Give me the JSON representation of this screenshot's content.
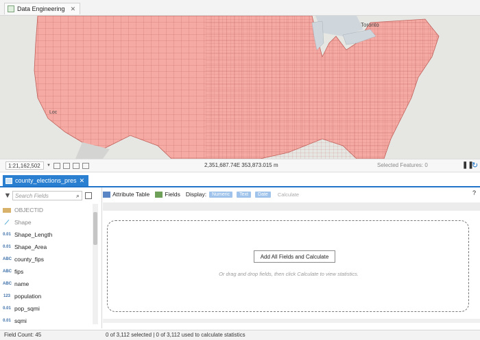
{
  "window": {
    "tab_title": "Data Engineering",
    "tab_icon": "map-view-icon"
  },
  "map": {
    "labels": [
      "Toronto",
      "Loc"
    ],
    "fill_color": "#f5aaa4",
    "border_color": "#c0605a",
    "background_color": "#e6e7e3"
  },
  "map_status": {
    "scale": "1:21,162,502",
    "coordinates": "2,351,687.74E 353,873.015 m",
    "selected_features": "Selected Features: 0"
  },
  "panel": {
    "tab_title": "county_elections_pres"
  },
  "field_search": {
    "placeholder": "Search Fields"
  },
  "fields": [
    {
      "label": "OBJECTID",
      "icon": "objectid-icon",
      "dim": true
    },
    {
      "label": "Shape",
      "icon": "shape-icon",
      "dim": true
    },
    {
      "label": "Shape_Length",
      "icon": "numeric-field-icon",
      "dim": false
    },
    {
      "label": "Shape_Area",
      "icon": "numeric-field-icon",
      "dim": false
    },
    {
      "label": "county_fips",
      "icon": "text-field-icon",
      "dim": false
    },
    {
      "label": "fips",
      "icon": "text-field-icon",
      "dim": false
    },
    {
      "label": "name",
      "icon": "text-field-icon",
      "dim": false
    },
    {
      "label": "population",
      "icon": "integer-field-icon",
      "dim": false
    },
    {
      "label": "pop_sqmi",
      "icon": "numeric-field-icon",
      "dim": false
    },
    {
      "label": "sqmi",
      "icon": "numeric-field-icon",
      "dim": false
    }
  ],
  "toolbar": {
    "attribute_table": "Attribute Table",
    "fields": "Fields",
    "display": "Display:",
    "numeric": "Numeric",
    "text": "Text",
    "date": "Date",
    "calculate": "Calculate",
    "help": "?"
  },
  "statistics": {
    "add_button": "Add All Fields and Calculate",
    "hint": "Or drag and drop fields, then click Calculate to view statistics."
  },
  "footer": {
    "field_count": "Field Count: 45",
    "selection_status": "0 of 3,112 selected | 0 of 3,112 used to calculate statistics"
  }
}
